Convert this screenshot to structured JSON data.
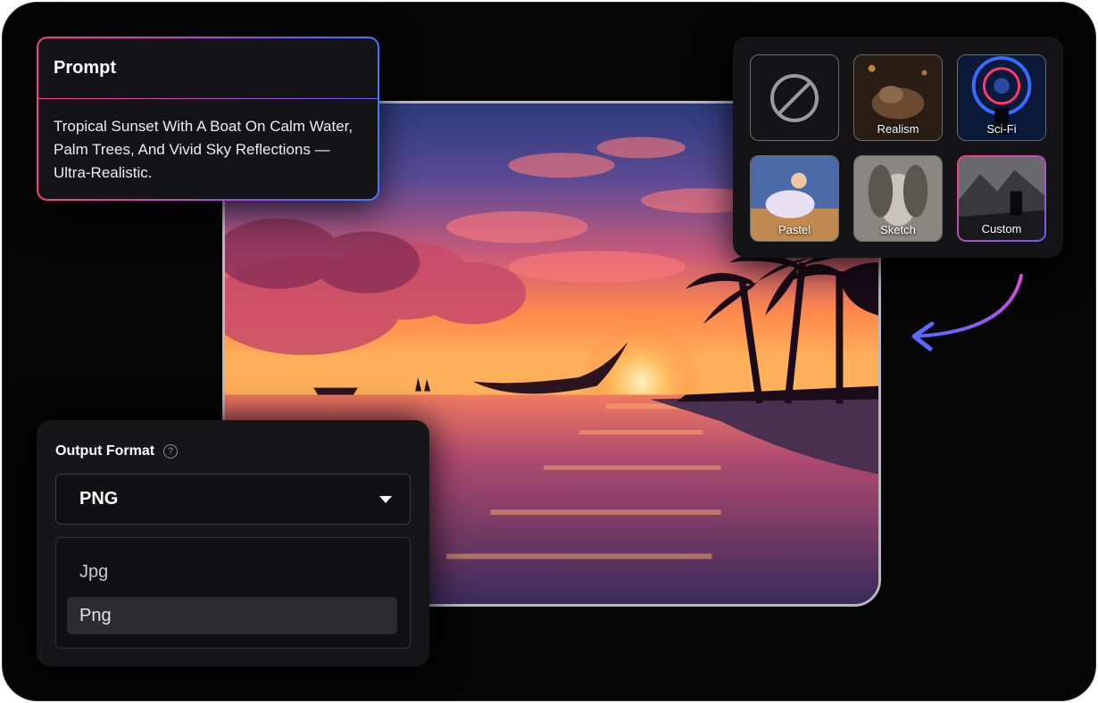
{
  "prompt": {
    "title": "Prompt",
    "text": "Tropical Sunset With A Boat On Calm Water, Palm Trees, And Vivid Sky Reflections — Ultra-Realistic."
  },
  "styles": {
    "items": [
      {
        "label": "",
        "icon": "no-style-icon"
      },
      {
        "label": "Realism"
      },
      {
        "label": "Sci-Fi"
      },
      {
        "label": "Pastel"
      },
      {
        "label": "Sketch"
      },
      {
        "label": "Custom",
        "selected": true
      }
    ]
  },
  "output_format": {
    "title": "Output Format",
    "help_icon": "?",
    "selected": "PNG",
    "options": [
      {
        "label": "Jpg"
      },
      {
        "label": "Png",
        "selected": true
      }
    ]
  },
  "colors": {
    "accent_pink": "#ff3f7b",
    "accent_blue": "#3b7bff",
    "panel": "#141416",
    "background": "#050505"
  }
}
